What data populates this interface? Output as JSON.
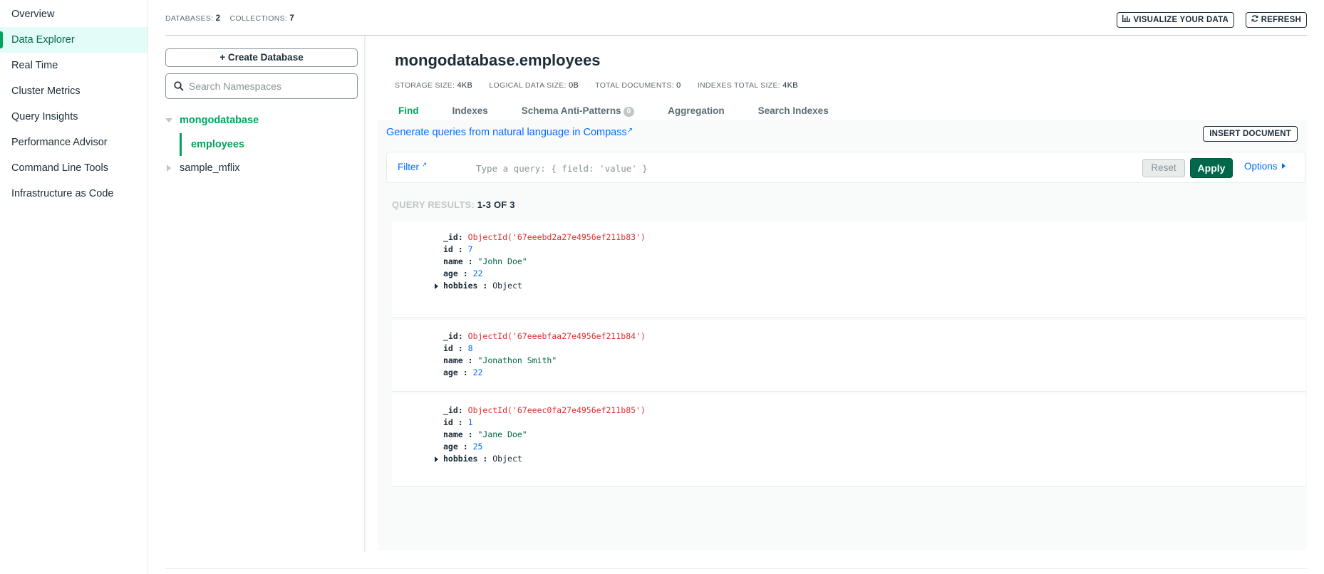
{
  "nav": {
    "items": [
      {
        "label": "Overview"
      },
      {
        "label": "Data Explorer",
        "active": true
      },
      {
        "label": "Real Time"
      },
      {
        "label": "Cluster Metrics"
      },
      {
        "label": "Query Insights"
      },
      {
        "label": "Performance Advisor"
      },
      {
        "label": "Command Line Tools"
      },
      {
        "label": "Infrastructure as Code"
      }
    ]
  },
  "topbar": {
    "databases_label": "DATABASES:",
    "databases_count": "2",
    "collections_label": "COLLECTIONS:",
    "collections_count": "7",
    "visualize_label": "VISUALIZE YOUR DATA",
    "visualize_icon": "bar-chart-icon",
    "refresh_label": "REFRESH",
    "refresh_icon": "refresh-icon"
  },
  "namespaces": {
    "create_label": "+  Create Database",
    "search_placeholder": "Search Namespaces",
    "search_icon": "search-icon",
    "databases": [
      {
        "name": "mongodatabase",
        "expanded": true,
        "collections": [
          "employees"
        ]
      },
      {
        "name": "sample_mflix",
        "expanded": false
      }
    ]
  },
  "collection": {
    "title": "mongodatabase.employees",
    "stats": {
      "storage_label": "STORAGE SIZE:",
      "storage_value": "4KB",
      "logical_label": "LOGICAL DATA SIZE:",
      "logical_value": "0B",
      "docs_label": "TOTAL DOCUMENTS:",
      "docs_value": "0",
      "indexes_label": "INDEXES TOTAL SIZE:",
      "indexes_value": "4KB"
    },
    "tabs": [
      {
        "label": "Find",
        "active": true
      },
      {
        "label": "Indexes"
      },
      {
        "label": "Schema Anti-Patterns",
        "badge": "0"
      },
      {
        "label": "Aggregation"
      },
      {
        "label": "Search Indexes"
      }
    ]
  },
  "query": {
    "nl_link": "Generate queries from natural language in Compass",
    "insert_label": "INSERT DOCUMENT",
    "filter_label": "Filter",
    "filter_placeholder": "Type a query: { field: 'value' }",
    "reset_label": "Reset",
    "apply_label": "Apply",
    "options_label": "Options",
    "results_label": "QUERY RESULTS:",
    "results_range": "1-3 OF 3"
  },
  "documents": [
    {
      "_id": "ObjectId('67eeebd2a27e4956ef211b83')",
      "id": "7",
      "name": "\"John Doe\"",
      "age": "22",
      "hobbies": "Object"
    },
    {
      "_id": "ObjectId('67eeebfaa27e4956ef211b84')",
      "id": "8",
      "name": "\"Jonathon Smith\"",
      "age": "22"
    },
    {
      "_id": "ObjectId('67eeec0fa27e4956ef211b85')",
      "id": "1",
      "name": "\"Jane Doe\"",
      "age": "25",
      "hobbies": "Object"
    }
  ],
  "colors": {
    "accent_green": "#00a35c",
    "dark_green": "#00684a",
    "link_blue": "#016bf8",
    "objectid_red": "#db3030"
  }
}
